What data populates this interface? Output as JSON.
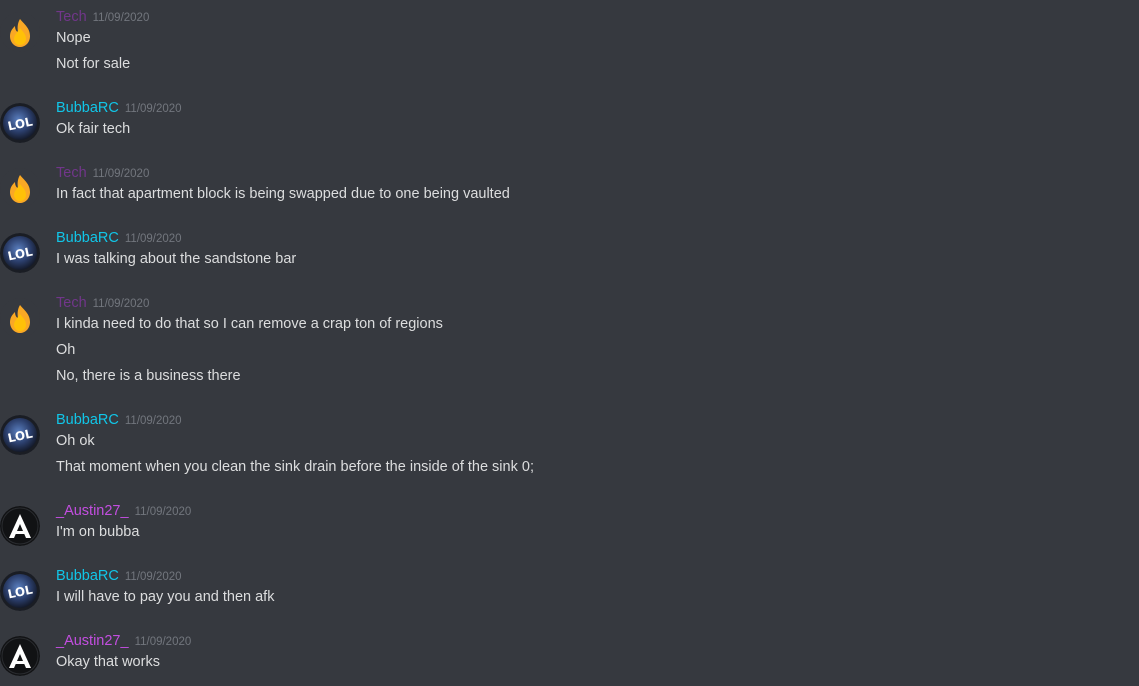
{
  "colors": {
    "background": "#36393f",
    "text": "#dcddde",
    "timestamp": "#72767d",
    "tech": "#71368a",
    "bubba": "#1abc9c",
    "austin": "#b053e0"
  },
  "users": {
    "tech": {
      "name": "Tech",
      "color": "#71368a",
      "avatar_icon": "flame-icon"
    },
    "bubba": {
      "name": "BubbaRC",
      "color": "#11c6e8",
      "avatar_icon": "lol-logo-icon"
    },
    "austin": {
      "name": "_Austin27_",
      "color": "#c34ee0",
      "avatar_icon": "letter-a-icon"
    }
  },
  "messages": [
    {
      "user": "tech",
      "author": "Tech",
      "timestamp": "11/09/2020",
      "lines": [
        "Nope",
        "Not for sale"
      ]
    },
    {
      "user": "bubba",
      "author": "BubbaRC",
      "timestamp": "11/09/2020",
      "lines": [
        "Ok fair tech"
      ]
    },
    {
      "user": "tech",
      "author": "Tech",
      "timestamp": "11/09/2020",
      "lines": [
        "In fact that apartment block is being swapped due to one being vaulted"
      ]
    },
    {
      "user": "bubba",
      "author": "BubbaRC",
      "timestamp": "11/09/2020",
      "lines": [
        "I was talking about the sandstone bar"
      ]
    },
    {
      "user": "tech",
      "author": "Tech",
      "timestamp": "11/09/2020",
      "lines": [
        "I kinda need to do that so I can remove a crap ton of regions",
        "Oh",
        "No, there is a business there"
      ]
    },
    {
      "user": "bubba",
      "author": "BubbaRC",
      "timestamp": "11/09/2020",
      "lines": [
        "Oh ok",
        "That moment when you clean the sink drain before the inside of the sink 0;"
      ]
    },
    {
      "user": "austin",
      "author": "_Austin27_",
      "timestamp": "11/09/2020",
      "lines": [
        "I'm on bubba"
      ]
    },
    {
      "user": "bubba",
      "author": "BubbaRC",
      "timestamp": "11/09/2020",
      "lines": [
        "I will have to pay you and then afk"
      ]
    },
    {
      "user": "austin",
      "author": "_Austin27_",
      "timestamp": "11/09/2020",
      "lines": [
        "Okay that works"
      ]
    }
  ]
}
